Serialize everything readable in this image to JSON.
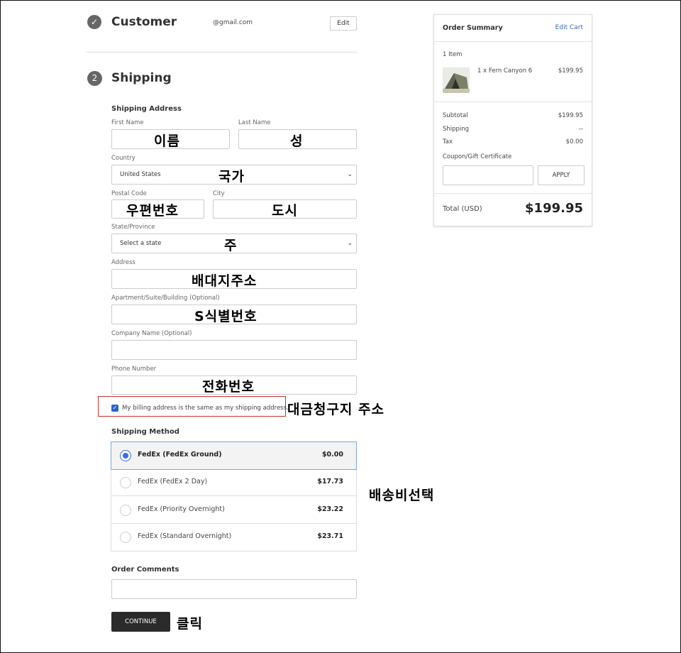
{
  "customer": {
    "title": "Customer",
    "email": "@gmail.com",
    "edit_label": "Edit"
  },
  "shipping": {
    "step": "2",
    "title": "Shipping",
    "address_title": "Shipping Address",
    "first_name_label": "First Name",
    "last_name_label": "Last Name",
    "country_label": "Country",
    "country_value": "United States",
    "postal_label": "Postal Code",
    "city_label": "City",
    "state_label": "State/Province",
    "state_value": "Select a state",
    "address_label": "Address",
    "apartment_label": "Apartment/Suite/Building (Optional)",
    "company_label": "Company Name (Optional)",
    "phone_label": "Phone Number",
    "billing_same_label": "My billing address is the same as my shipping address.",
    "billing_same_checked": true,
    "method_title": "Shipping Method",
    "methods": [
      {
        "name": "FedEx (FedEx Ground)",
        "price": "$0.00",
        "selected": true
      },
      {
        "name": "FedEx (FedEx 2 Day)",
        "price": "$17.73",
        "selected": false
      },
      {
        "name": "FedEx (Priority Overnight)",
        "price": "$23.22",
        "selected": false
      },
      {
        "name": "FedEx (Standard Overnight)",
        "price": "$23.71",
        "selected": false
      }
    ],
    "comments_title": "Order Comments",
    "continue_label": "CONTINUE"
  },
  "annotations": {
    "first_name": "이름",
    "last_name": "성",
    "country": "국가",
    "postal": "우편번호",
    "city": "도시",
    "state": "주",
    "address": "배대지주소",
    "apartment": "S식별번호",
    "phone": "전화번호",
    "billing": "대금청구지 주소",
    "shipping_method": "배송비선택",
    "continue": "클릭"
  },
  "summary": {
    "title": "Order Summary",
    "edit_cart": "Edit Cart",
    "item_count": "1 Item",
    "item_name": "1 x Fern Canyon 6",
    "item_price": "$199.95",
    "subtotal_label": "Subtotal",
    "subtotal_value": "$199.95",
    "shipping_label": "Shipping",
    "shipping_value": "--",
    "tax_label": "Tax",
    "tax_value": "$0.00",
    "coupon_label": "Coupon/Gift Certificate",
    "apply_label": "APPLY",
    "total_label": "Total (USD)",
    "total_value": "$199.95"
  },
  "colors": {
    "accent_blue": "#3d6ce0",
    "link_blue": "#3a6bb5",
    "highlight_red": "#c9302c",
    "button_dark": "#2b2b2b"
  }
}
